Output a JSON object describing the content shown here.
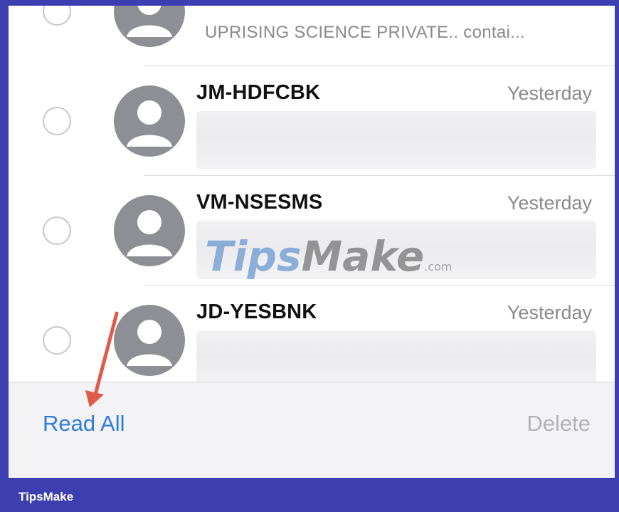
{
  "messages_partial": {
    "preview": "UPRISING SCIENCE PRIVATE.. contai..."
  },
  "messages": [
    {
      "sender": "JM-HDFCBK",
      "time": "Yesterday"
    },
    {
      "sender": "VM-NSESMS",
      "time": "Yesterday"
    },
    {
      "sender": "JD-YESBNK",
      "time": "Yesterday"
    }
  ],
  "toolbar": {
    "read_all_label": "Read All",
    "delete_label": "Delete"
  },
  "watermark": {
    "part1": "Tips",
    "part2": "Make",
    "suffix": ".com"
  },
  "footer": {
    "brand": "TipsMake"
  },
  "colors": {
    "accent": "#2f7bd9",
    "disabled": "#b4b4b8",
    "frame_border": "#3d3fb0",
    "annotation_arrow": "#e05a4a"
  },
  "icons": {
    "avatar": "person-avatar-icon",
    "selection": "selection-circle-icon",
    "annotation": "red-arrow-icon"
  }
}
